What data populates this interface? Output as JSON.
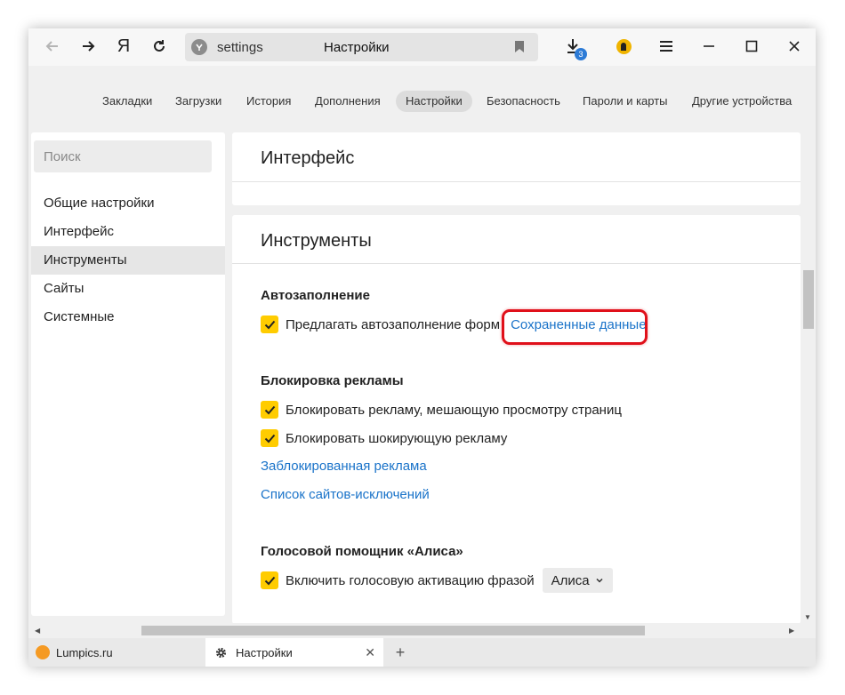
{
  "toolbar": {
    "back_icon": "arrow-left-icon",
    "forward_icon": "arrow-right-icon",
    "yandex_logo": "Я",
    "reload_icon": "reload-icon",
    "address_url": "settings",
    "address_title": "Настройки",
    "bookmark_icon": "bookmark-icon",
    "downloads_icon": "download-icon",
    "downloads_count": "3",
    "alice_icon": "alice-icon",
    "menu_icon": "hamburger-icon",
    "minimize_icon": "minimize-icon",
    "maximize_icon": "maximize-icon",
    "close_icon": "close-icon"
  },
  "topnav": {
    "tabs": [
      {
        "label": "Закладки",
        "active": false
      },
      {
        "label": "Загрузки",
        "active": false
      },
      {
        "label": "История",
        "active": false
      },
      {
        "label": "Дополнения",
        "active": false
      },
      {
        "label": "Настройки",
        "active": true
      },
      {
        "label": "Безопасность",
        "active": false
      },
      {
        "label": "Пароли и карты",
        "active": false
      },
      {
        "label": "Другие устройства",
        "active": false
      }
    ]
  },
  "sidebar": {
    "search_placeholder": "Поиск",
    "items": [
      {
        "label": "Общие настройки",
        "active": false
      },
      {
        "label": "Интерфейс",
        "active": false
      },
      {
        "label": "Инструменты",
        "active": true
      },
      {
        "label": "Сайты",
        "active": false
      },
      {
        "label": "Системные",
        "active": false
      }
    ]
  },
  "main": {
    "interface_title": "Интерфейс",
    "tools_title": "Инструменты",
    "autofill": {
      "heading": "Автозаполнение",
      "option_label": "Предлагать автозаполнение форм",
      "option_checked": true,
      "link": "Сохраненные данные"
    },
    "adblock": {
      "heading": "Блокировка рекламы",
      "option1_label": "Блокировать рекламу, мешающую просмотру страниц",
      "option1_checked": true,
      "option2_label": "Блокировать шокирующую рекламу",
      "option2_checked": true,
      "link1": "Заблокированная реклама",
      "link2": "Список сайтов-исключений"
    },
    "alice": {
      "heading": "Голосовой помощник «Алиса»",
      "option_label": "Включить голосовую активацию фразой",
      "option_checked": true,
      "select_value": "Алиса"
    }
  },
  "tabs": [
    {
      "label": "Lumpics.ru",
      "icon": "orange-favicon-icon",
      "active": false
    },
    {
      "label": "Настройки",
      "icon": "gear-icon",
      "active": true
    }
  ],
  "new_tab_label": "+",
  "colors": {
    "checkbox": "#ffcc00",
    "link": "#1a73c9",
    "highlight": "#e0101a",
    "badge": "#2d7bd6"
  }
}
